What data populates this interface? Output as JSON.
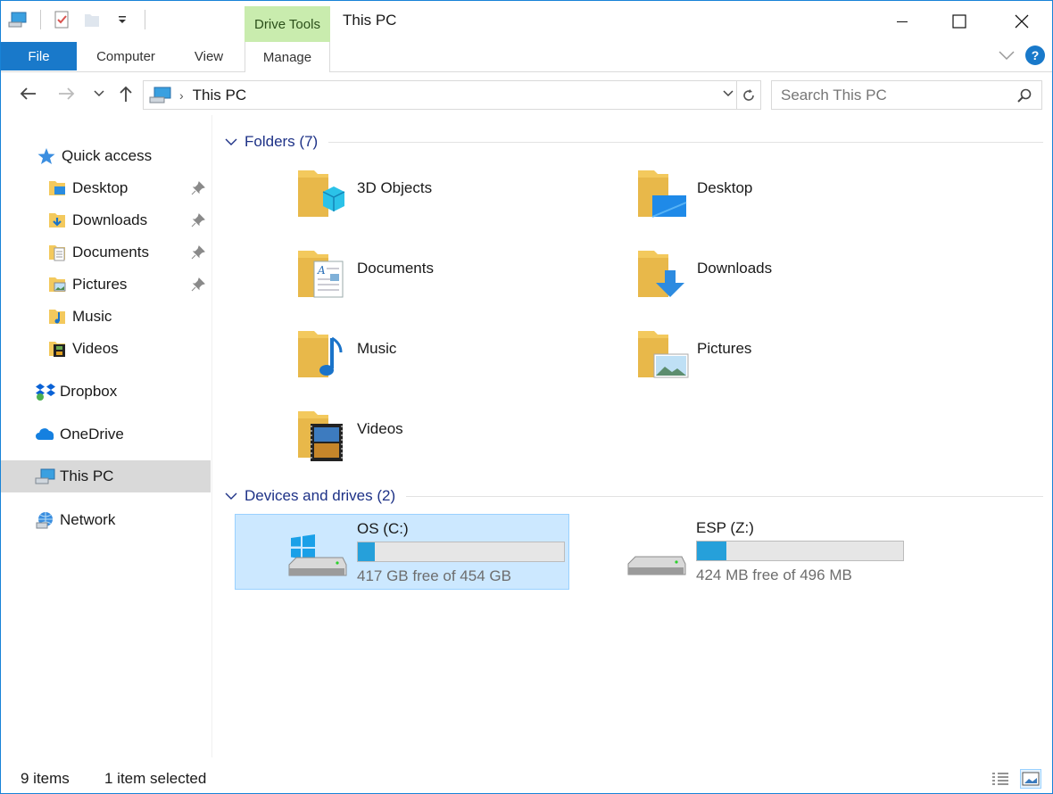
{
  "window": {
    "title": "This PC",
    "contextual_tab_group": "Drive Tools"
  },
  "ribbon": {
    "file_tab": "File",
    "tabs": [
      "Computer",
      "View",
      "Manage"
    ]
  },
  "address": {
    "crumb": "This PC",
    "search_placeholder": "Search This PC"
  },
  "nav": {
    "quick_access": "Quick access",
    "quick_items": [
      {
        "label": "Desktop",
        "pinned": true
      },
      {
        "label": "Downloads",
        "pinned": true
      },
      {
        "label": "Documents",
        "pinned": true
      },
      {
        "label": "Pictures",
        "pinned": true
      },
      {
        "label": "Music",
        "pinned": false
      },
      {
        "label": "Videos",
        "pinned": false
      }
    ],
    "dropbox": "Dropbox",
    "onedrive": "OneDrive",
    "this_pc": "This PC",
    "network": "Network"
  },
  "content": {
    "folders_header": "Folders (7)",
    "folders": [
      "3D Objects",
      "Desktop",
      "Documents",
      "Downloads",
      "Music",
      "Pictures",
      "Videos"
    ],
    "drives_header": "Devices and drives (2)",
    "drives": [
      {
        "name": "OS (C:)",
        "size_text": "417 GB free of 454 GB",
        "used_fraction": 0.081,
        "selected": true
      },
      {
        "name": "ESP (Z:)",
        "size_text": "424 MB free of 496 MB",
        "used_fraction": 0.145,
        "selected": false
      }
    ]
  },
  "status": {
    "items": "9 items",
    "selected": "1 item selected"
  },
  "colors": {
    "accent": "#1979ca",
    "drive_tools": "#c9ecae",
    "selection": "#cce8ff",
    "group_header": "#1e3287",
    "bar_fill": "#26a0da"
  }
}
